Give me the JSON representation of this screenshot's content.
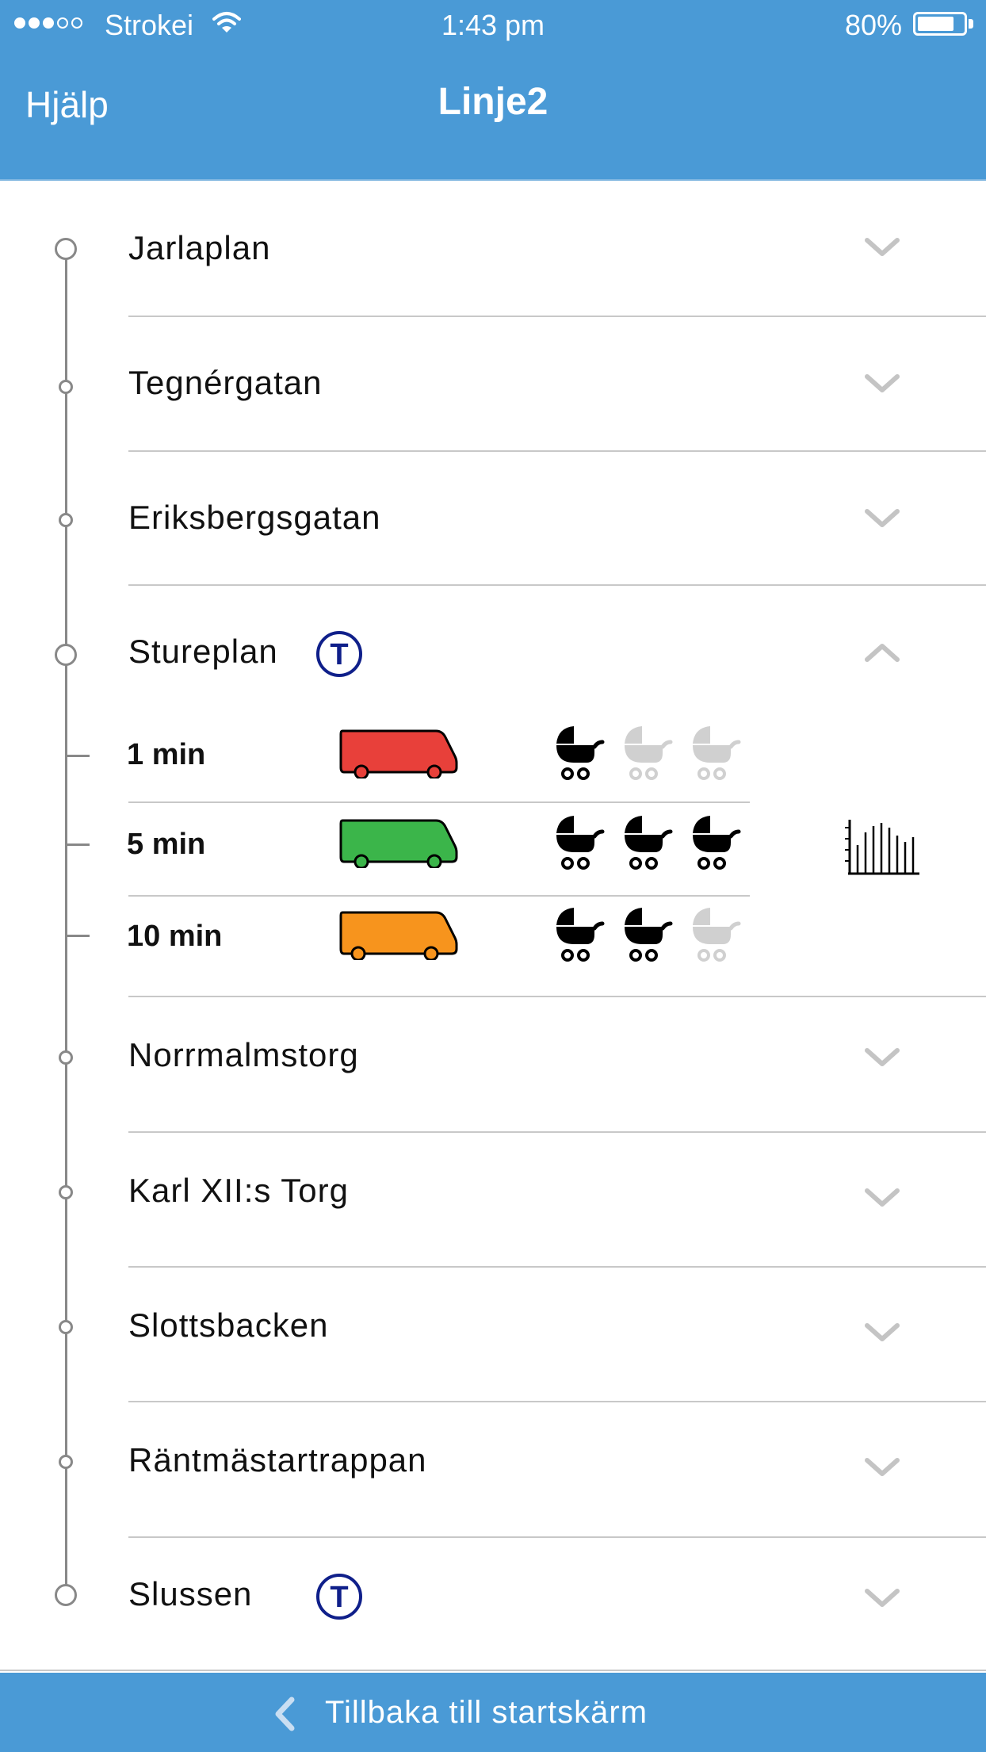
{
  "status_bar": {
    "carrier": "Strokei",
    "time": "1:43 pm",
    "battery": "80%",
    "battery_level": 0.8,
    "signal_bars": 3,
    "signal_total": 5
  },
  "nav": {
    "help_label": "Hjälp",
    "title": "Linje2"
  },
  "stops": [
    {
      "name": "Jarlaplan",
      "metro": false,
      "expanded": false
    },
    {
      "name": "Tegnérgatan",
      "metro": false,
      "expanded": false
    },
    {
      "name": "Eriksbergsgatan",
      "metro": false,
      "expanded": false
    },
    {
      "name": "Stureplan",
      "metro": true,
      "expanded": true
    },
    {
      "name": "Norrmalmstorg",
      "metro": false,
      "expanded": false
    },
    {
      "name": "Karl XII:s Torg",
      "metro": false,
      "expanded": false
    },
    {
      "name": "Slottsbacken",
      "metro": false,
      "expanded": false
    },
    {
      "name": "Räntmästartrappan",
      "metro": false,
      "expanded": false
    },
    {
      "name": "Slussen",
      "metro": true,
      "expanded": false
    }
  ],
  "departures": [
    {
      "time": "1 min",
      "bus_color": "#e8403a",
      "wheel_color": "#e8403a",
      "stroller_available": 1,
      "stroller_total": 3
    },
    {
      "time": "5 min",
      "bus_color": "#3bb54a",
      "wheel_color": "#3bb54a",
      "stroller_available": 3,
      "stroller_total": 3
    },
    {
      "time": "10 min",
      "bus_color": "#f7941d",
      "wheel_color": "#f7941d",
      "stroller_available": 2,
      "stroller_total": 3
    }
  ],
  "metro_symbol": "T",
  "icons": {
    "stroller": "stroller-icon",
    "bus": "bus-icon",
    "chart": "bar-chart-icon",
    "metro": "metro-t-icon",
    "back": "chevron-left-icon"
  },
  "colors": {
    "header_blue": "#4a9ad6",
    "metro_blue": "#0f1f8a",
    "stroller_active": "#000000",
    "stroller_inactive": "#d0d0d0"
  },
  "bottom_bar": {
    "back_label": "Tillbaka till startskärm"
  }
}
